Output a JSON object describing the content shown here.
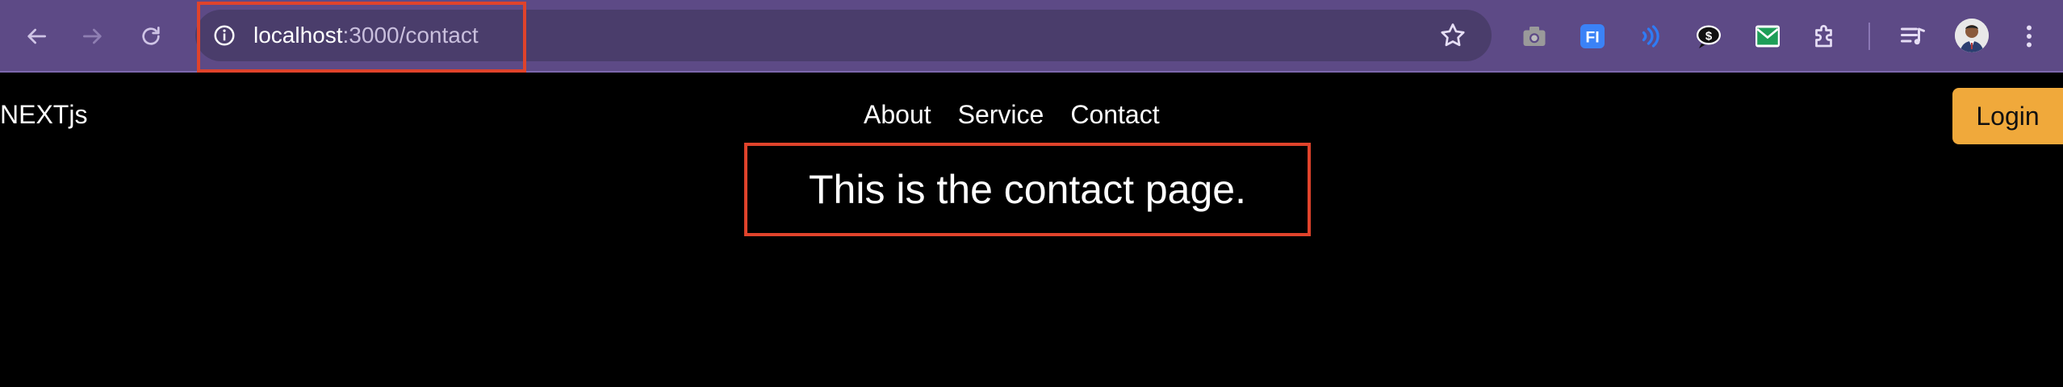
{
  "browser": {
    "url_host": "localhost",
    "url_path": ":3000/contact",
    "icons": [
      "back-icon",
      "forward-icon",
      "reload-icon",
      "site-info-icon",
      "bookmark-star-icon",
      "camera-extension-icon",
      "fi-extension-icon",
      "audio-extension-icon",
      "chat-extension-icon",
      "mail-extension-icon",
      "extensions-puzzle-icon",
      "media-queue-icon",
      "profile-avatar",
      "menu-kebab-icon"
    ],
    "ext_fi_label": "FI"
  },
  "site": {
    "logo": "NEXTjs",
    "nav": [
      "About",
      "Service",
      "Contact"
    ],
    "login_label": "Login",
    "main_text": "This is the contact page."
  },
  "colors": {
    "toolbar": "#5d4a86",
    "omnibox": "#4a3d6b",
    "page_bg": "#000000",
    "login_bg": "#f0a93b",
    "annotation": "#e0432b"
  }
}
